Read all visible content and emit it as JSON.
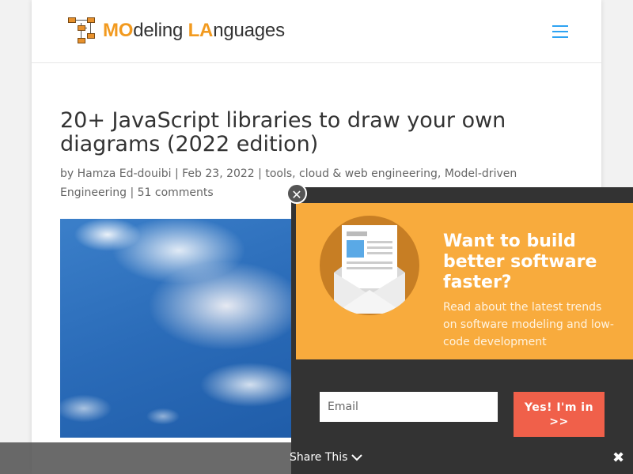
{
  "header": {
    "logo_text_1": "MO",
    "logo_text_2": "deling ",
    "logo_text_3": "LA",
    "logo_text_4": "nguages",
    "menu_icon": "hamburger-icon"
  },
  "article": {
    "title": "20+ JavaScript libraries to draw your own diagrams (2022 edition)",
    "meta": "by Hamza Ed-douibi | Feb 23, 2022 | tools, cloud & web engineering, Model-driven Engineering | 51 comments"
  },
  "popup": {
    "heading": "Want to build better software faster?",
    "text": "Read about the latest trends on software modeling and low-code development",
    "email_placeholder": "Email",
    "button_label": "Yes! I'm in >>",
    "close_icon": "close-icon",
    "illustration": "envelope-newsletter-icon"
  },
  "share_bar": {
    "label": "Share This",
    "chevron_icon": "chevron-down-icon",
    "close_icon": "close-icon"
  },
  "colors": {
    "accent": "#2ea3f2",
    "logo_orange": "#f29a1f",
    "popup_orange": "#f8ab3d",
    "button_red": "#f0604a",
    "dark": "#333333"
  }
}
